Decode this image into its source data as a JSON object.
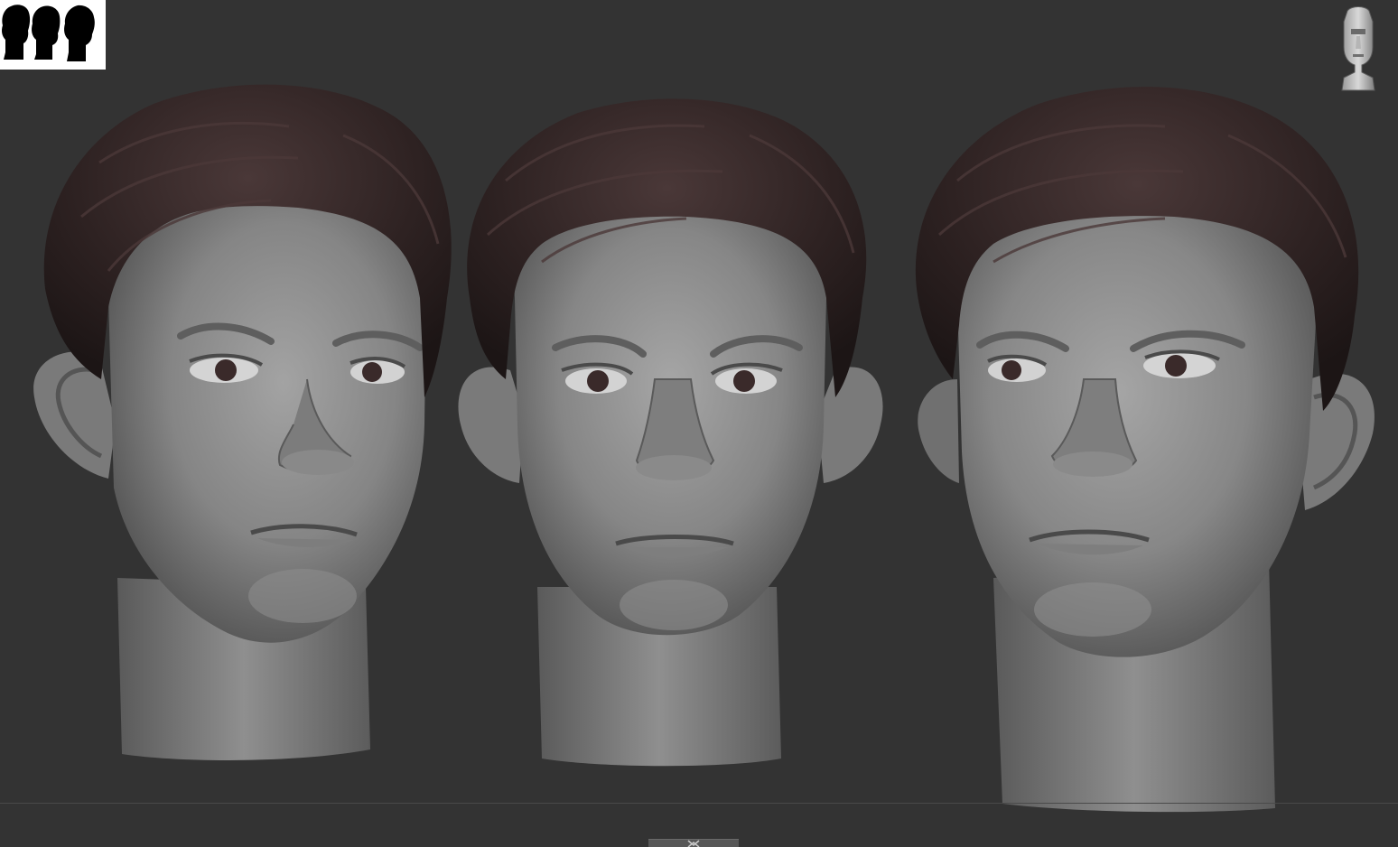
{
  "app": {
    "canvas_background": "#333333",
    "sculpt_skin_color": "#8e8e8e",
    "sculpt_hair_color": "#2f2323"
  },
  "toolbar": {
    "thumbnail_icon": "silhouette-preview-icon",
    "navigation_icon": "head-navigation-gizmo-icon"
  },
  "scene": {
    "views": [
      {
        "view": "three-quarter-left"
      },
      {
        "view": "front"
      },
      {
        "view": "three-quarter-right"
      }
    ]
  }
}
